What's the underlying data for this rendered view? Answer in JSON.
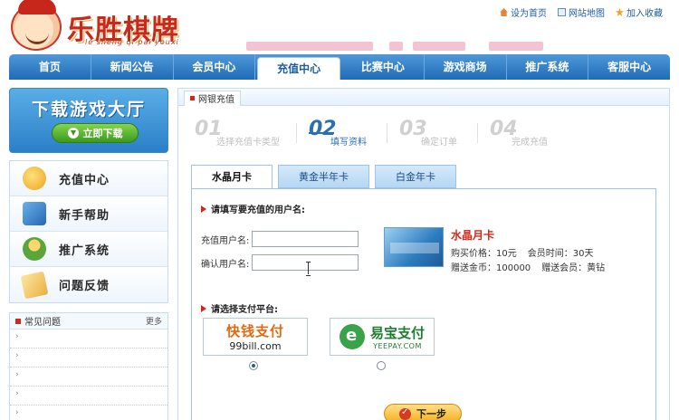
{
  "logo": {
    "text": "乐胜棋牌",
    "sub": "le sheng qi pai youxi"
  },
  "toplinks": [
    {
      "label": "设为首页",
      "icon": "home-icon"
    },
    {
      "label": "网站地图",
      "icon": "sitemap-icon"
    },
    {
      "label": "加入收藏",
      "icon": "star-icon"
    }
  ],
  "nav": [
    "首页",
    "新闻公告",
    "会员中心",
    "充值中心",
    "比赛中心",
    "游戏商场",
    "推广系统",
    "客服中心"
  ],
  "nav_active_index": 3,
  "download": {
    "title": "下载游戏大厅",
    "button": "立即下载"
  },
  "side_menu": [
    {
      "label": "充值中心",
      "icon": "recharge-icon"
    },
    {
      "label": "新手帮助",
      "icon": "help-book-icon"
    },
    {
      "label": "推广系统",
      "icon": "promotion-icon"
    },
    {
      "label": "问题反馈",
      "icon": "feedback-icon"
    }
  ],
  "faq": {
    "title": "常见问题",
    "more": "更多"
  },
  "main": {
    "section_tab": "网银充值",
    "steps": [
      {
        "num": "01",
        "label": "选择充值卡类型"
      },
      {
        "num": "02",
        "label": "填写资料"
      },
      {
        "num": "03",
        "label": "确定订单"
      },
      {
        "num": "04",
        "label": "完成充值"
      }
    ],
    "active_step": 1,
    "card_tabs": [
      "水晶月卡",
      "黄金半年卡",
      "白金年卡"
    ],
    "active_card_tab": 0,
    "user_section_title": "请填写要充值的用户名:",
    "fields": [
      {
        "label": "充值用户名:",
        "value": ""
      },
      {
        "label": "确认用户名:",
        "value": ""
      }
    ],
    "product": {
      "name": "水晶月卡",
      "price_label": "购买价格：10元",
      "time_label": "会员时间：30天",
      "gold_label": "赠送金币：100000",
      "member_label": "赠送会员：黄钻"
    },
    "pay_section_title": "请选择支付平台:",
    "payments": [
      {
        "top": "快钱支付",
        "sub": "99bill.com",
        "checked": true
      },
      {
        "top": "易宝支付",
        "sub": "YEEPAY.COM",
        "checked": false
      }
    ],
    "next_button": "下一步"
  },
  "colors": {
    "nav_blue": "#1f6bb5",
    "accent_red": "#cc2a1c",
    "step_active": "#2b6fb3"
  }
}
